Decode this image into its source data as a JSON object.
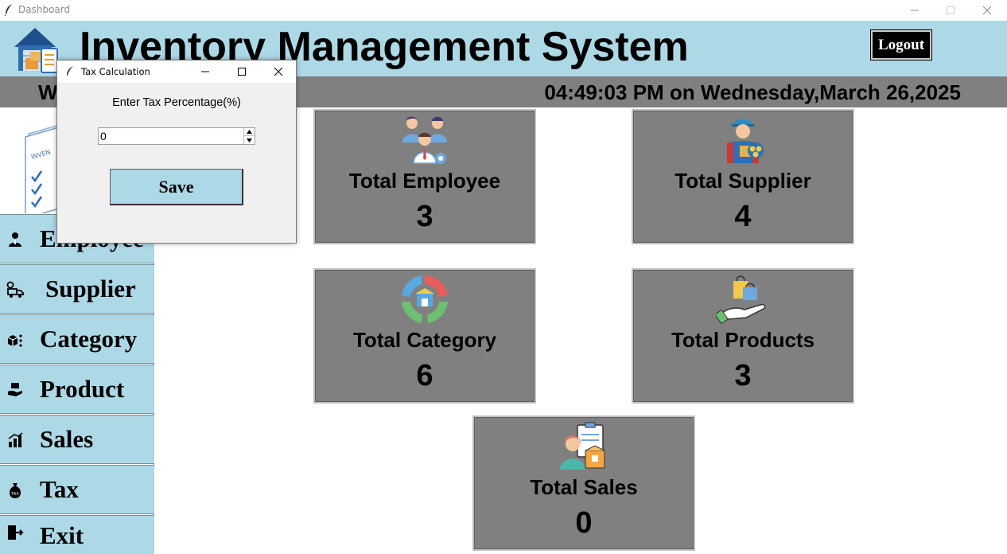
{
  "window": {
    "title": "Dashboard",
    "icon": "feather-icon"
  },
  "header": {
    "title": "Inventory Management System",
    "logo": "warehouse-logo-icon",
    "logout_label": "Logout",
    "background": "#add8e6"
  },
  "status": {
    "welcome_fragment": "W",
    "clock_text": "04:49:03 PM on Wednesday,March 26,2025",
    "background": "#808080"
  },
  "menu": {
    "illustration": "inventory-clipboard-icon",
    "items": [
      {
        "label": "Employee",
        "icon": "person-icon"
      },
      {
        "label": "Supplier",
        "icon": "delivery-truck-icon"
      },
      {
        "label": "Category",
        "icon": "boxes-icon"
      },
      {
        "label": "Product",
        "icon": "product-hand-icon"
      },
      {
        "label": "Sales",
        "icon": "bar-chart-icon"
      },
      {
        "label": "Tax",
        "icon": "tax-bag-icon"
      },
      {
        "label": "Exit",
        "icon": "exit-door-icon"
      }
    ]
  },
  "cards": [
    {
      "title": "Total Employee",
      "value": "3",
      "icon": "employees-group-icon"
    },
    {
      "title": "Total Supplier",
      "value": "4",
      "icon": "supplier-worker-icon"
    },
    {
      "title": "Total Category",
      "value": "6",
      "icon": "category-ring-icon"
    },
    {
      "title": "Total Products",
      "value": "3",
      "icon": "shopping-bags-hand-icon"
    },
    {
      "title": "Total Sales",
      "value": "0",
      "icon": "sales-clipboard-icon"
    }
  ],
  "dialog": {
    "title": "Tax Calculation",
    "prompt": "Enter Tax Percentage(%)",
    "value": "0",
    "save_label": "Save"
  }
}
